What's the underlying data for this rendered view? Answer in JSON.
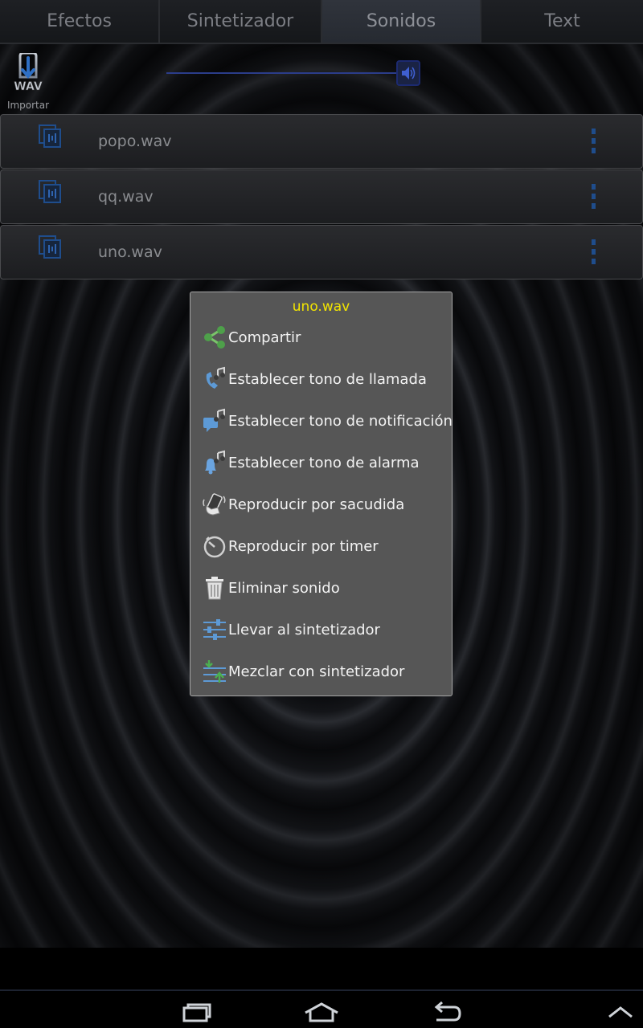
{
  "tabs": [
    {
      "label": "Efectos",
      "active": false
    },
    {
      "label": "Sintetizador",
      "active": false
    },
    {
      "label": "Sonidos",
      "active": true
    },
    {
      "label": "Text",
      "active": false
    }
  ],
  "toolbar": {
    "import_icon_text": "WAV",
    "import_label": "Importar",
    "volume_icon": "speaker-icon"
  },
  "sounds": [
    {
      "name": "popo.wav"
    },
    {
      "name": "qq.wav"
    },
    {
      "name": "uno.wav"
    }
  ],
  "context_menu": {
    "title": "uno.wav",
    "items": [
      {
        "label": "Compartir",
        "icon": "share-icon"
      },
      {
        "label": "Establecer tono de llamada",
        "icon": "phone-ringtone-icon"
      },
      {
        "label": "Establecer tono de notificación",
        "icon": "notification-tone-icon"
      },
      {
        "label": "Establecer tono de alarma",
        "icon": "alarm-bell-icon"
      },
      {
        "label": "Reproducir por sacudida",
        "icon": "shake-hand-icon"
      },
      {
        "label": "Reproducir por timer",
        "icon": "timer-icon"
      },
      {
        "label": "Eliminar sonido",
        "icon": "trash-icon"
      },
      {
        "label": "Llevar al sintetizador",
        "icon": "equalizer-icon"
      },
      {
        "label": "Mezclar con sintetizador",
        "icon": "mix-arrows-icon"
      }
    ]
  },
  "colors": {
    "title_accent": "#f2e400",
    "menu_background": "#565656",
    "slider_accent": "#2b3d8a"
  },
  "system_nav": [
    "recent-apps-icon",
    "home-icon",
    "back-icon",
    "menu-up-icon"
  ]
}
